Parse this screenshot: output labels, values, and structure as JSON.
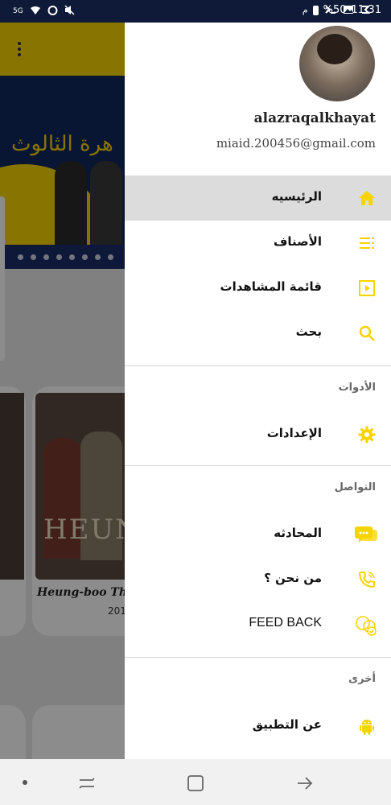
{
  "status_bar": {
    "time": "11:31",
    "battery": "%50",
    "network": "5G"
  },
  "background": {
    "banner_title": "هرة الثالوث",
    "movie_caption": "Heung-boo The",
    "movie_year": "201",
    "poster_text": "HEUN"
  },
  "drawer": {
    "username": "alazraqalkhayat",
    "email": "miaid.200456@gmail.com",
    "items": [
      {
        "label": "الرئيسيه",
        "icon": "home-icon"
      },
      {
        "label": "الأصناف",
        "icon": "categories-icon"
      },
      {
        "label": "قائمة المشاهدات",
        "icon": "watchlist-icon"
      },
      {
        "label": "بحث",
        "icon": "search-icon"
      }
    ],
    "tools_title": "الأدوات",
    "tools_items": [
      {
        "label": "الإعدادات",
        "icon": "gear-icon"
      }
    ],
    "contact_title": "التواصل",
    "contact_items": [
      {
        "label": "المحادثه",
        "icon": "chat-icon"
      },
      {
        "label": "من نحن ؟",
        "icon": "phone-icon"
      },
      {
        "label": "FEED BACK",
        "icon": "feedback-icon"
      }
    ],
    "other_title": "أخرى",
    "other_items": [
      {
        "label": "عن التطبيق",
        "icon": "android-icon"
      }
    ]
  },
  "colors": {
    "accent": "#f7d400",
    "active_row": "#dcdcdc",
    "status_bar": "#0f1a38"
  }
}
